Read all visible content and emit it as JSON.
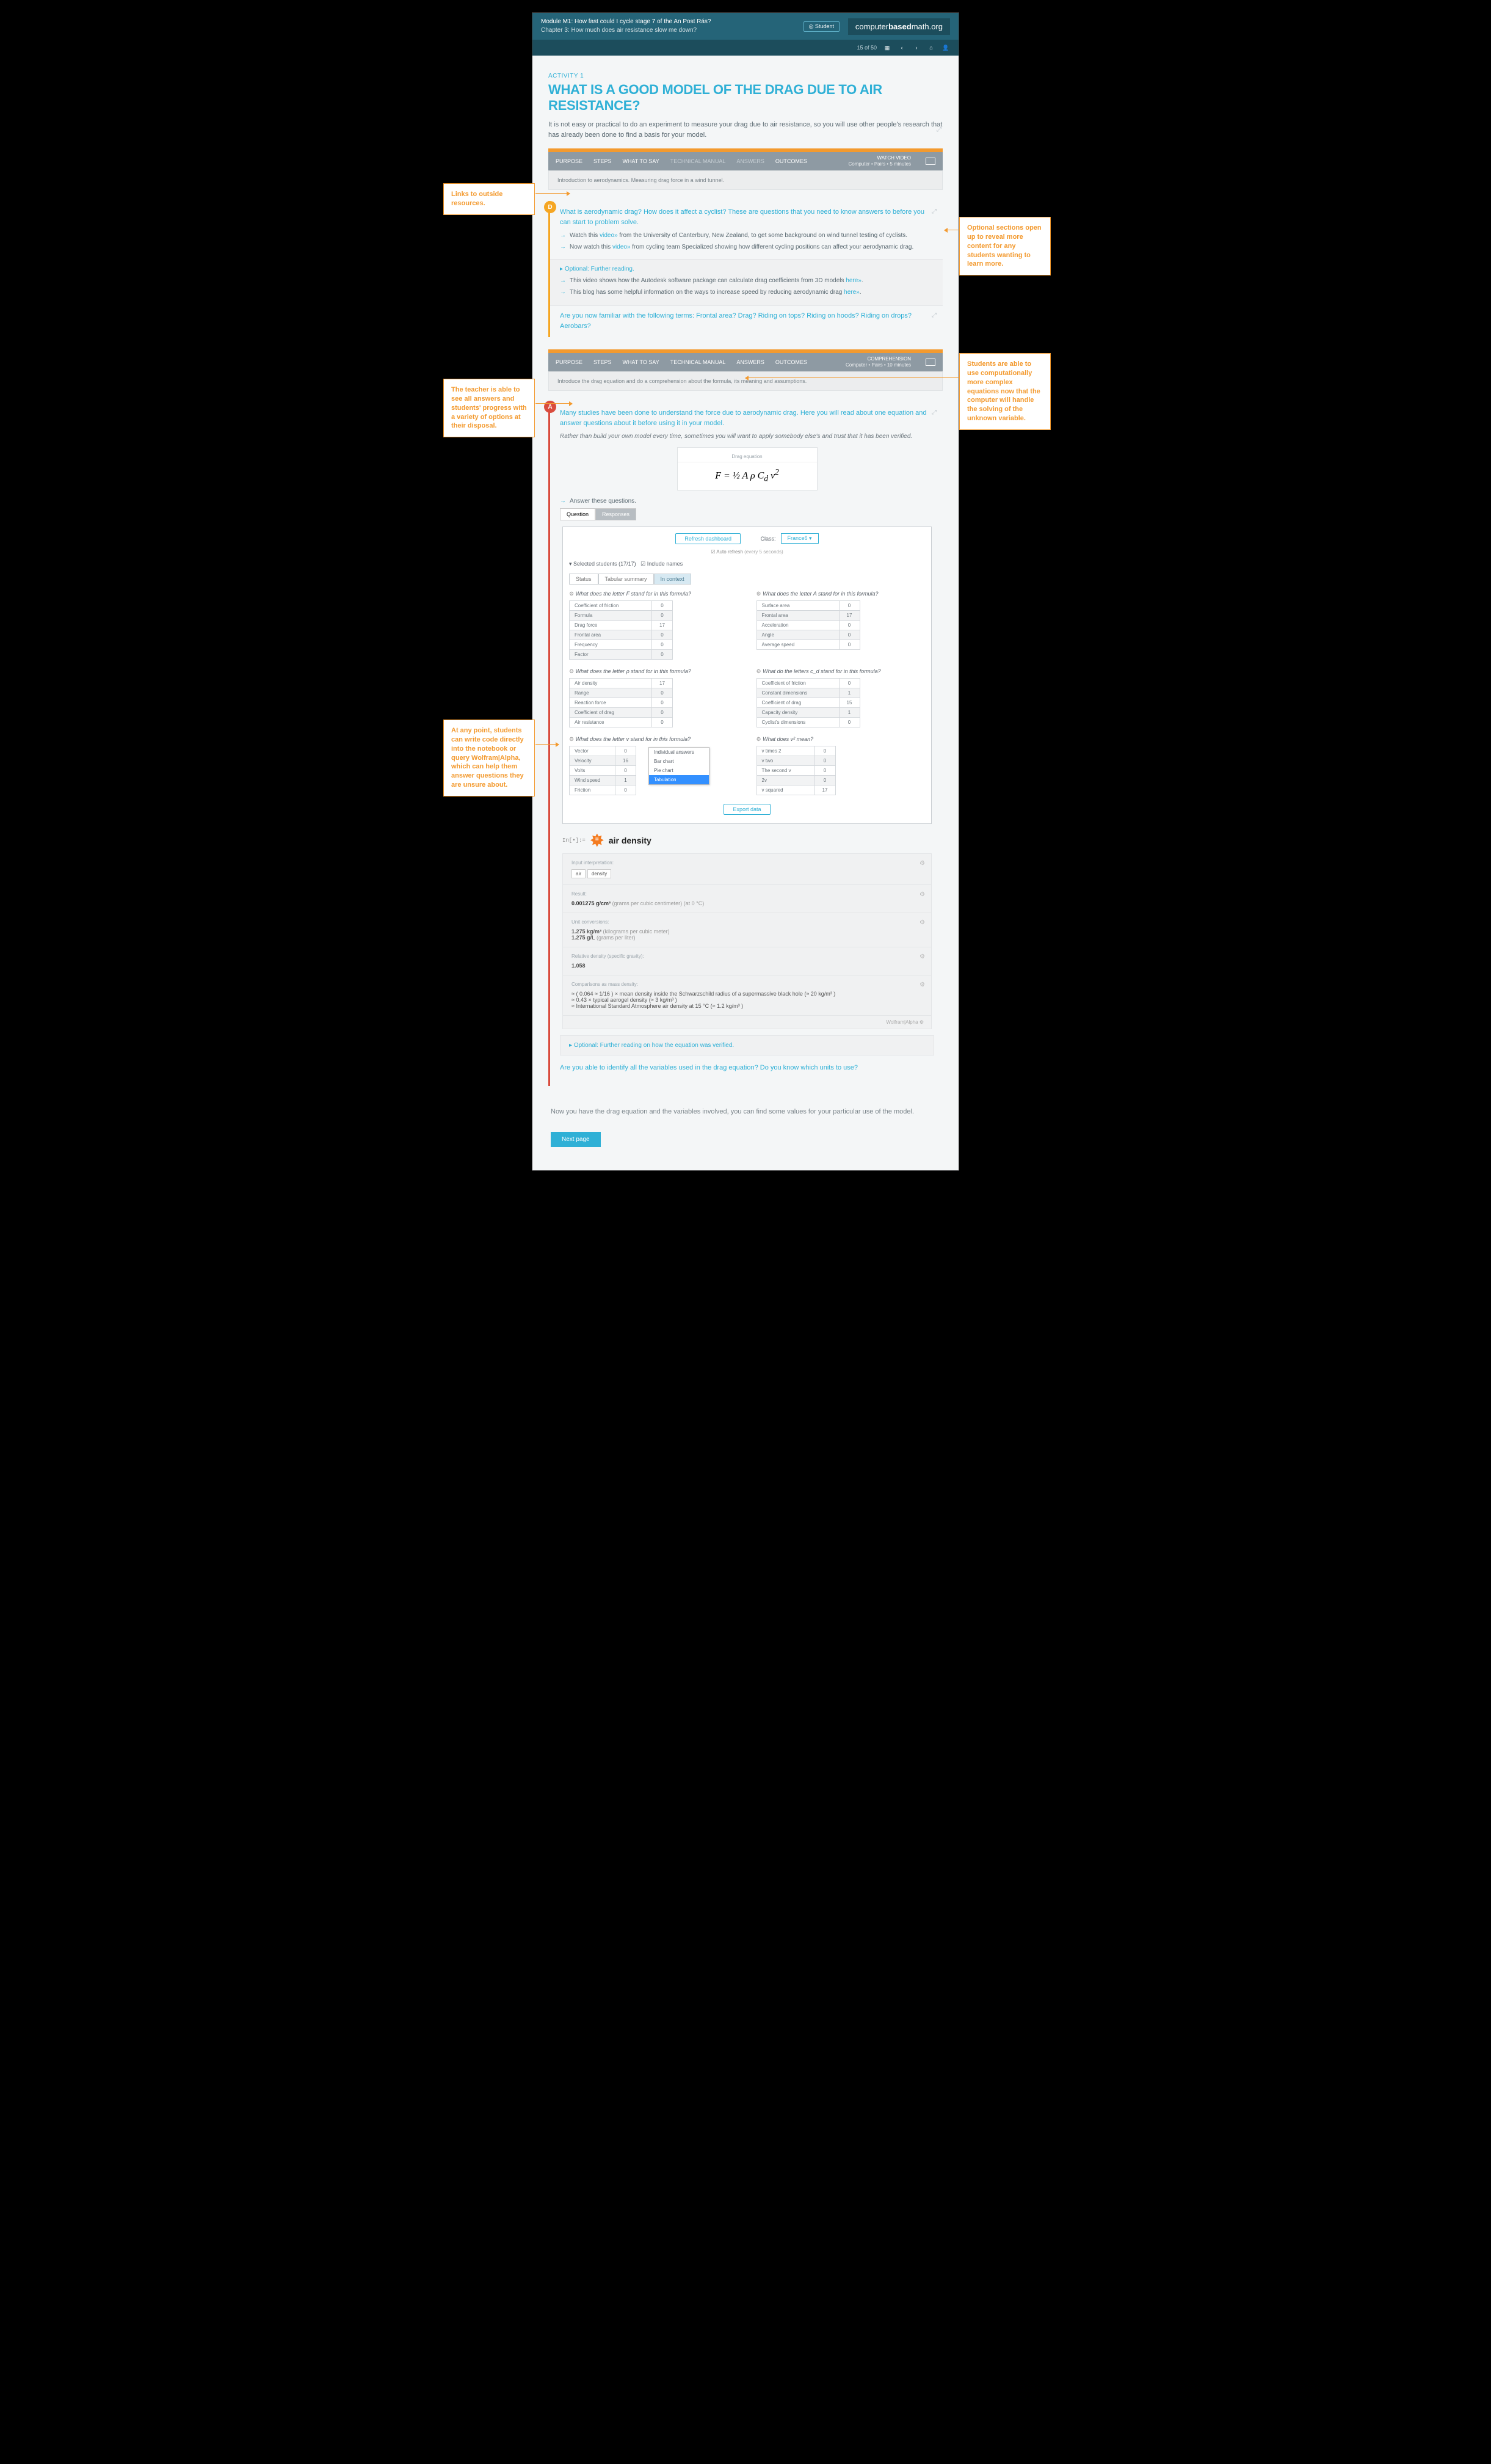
{
  "header": {
    "module": "Module M1: How fast could I cycle stage 7 of the An Post Rás?",
    "chapter": "Chapter 3: How much does air resistance slow me down?",
    "brand_light": "computer",
    "brand_bold": "based",
    "brand_end": "math.org",
    "student": "Student",
    "pagepos": "15 of 50"
  },
  "activity": {
    "label": "ACTIVITY 1",
    "title": "WHAT IS A GOOD MODEL OF THE DRAG DUE TO AIR RESISTANCE?",
    "intro": "It is not easy or practical to do an experiment to measure your drag due to air resistance, so you will use other people's research that has already been done to find a basis for your model."
  },
  "tabs": {
    "purpose": "PURPOSE",
    "steps": "STEPS",
    "say": "WHAT TO SAY",
    "tech": "TECHNICAL MANUAL",
    "answers": "ANSWERS",
    "outcomes": "OUTCOMES",
    "watch": "WATCH VIDEO",
    "watch_sub": "Computer • Pairs • 5 minutes",
    "desc1": "Introduction to aerodynamics. Measuring drag force in a wind tunnel.",
    "comp": "COMPREHENSION",
    "comp_sub": "Computer • Pairs • 10 minutes",
    "desc2": "Introduce the drag equation and do a comprehension about the formula, its meaning and assumptions."
  },
  "d": {
    "q1": "What is aerodynamic drag? How does it affect a cyclist? These are questions that you need to know answers to before you can start to problem solve.",
    "l1a": "Watch this ",
    "l1b": " from the University of Canterbury, New Zealand, to get some background on wind tunnel testing of cyclists.",
    "l2a": "Now watch this ",
    "l2b": " from cycling team Specialized showing how different cycling positions can affect your aerodynamic drag.",
    "link": "video»",
    "opt_hd": "Optional: Further reading.",
    "opt1a": "This video shows how the Autodesk software package can calculate drag coefficients from 3D models ",
    "opt2a": "This blog has some helpful information on the ways to increase speed by reducing aerodynamic drag ",
    "here": "here»",
    "q2": "Are you now familiar with the following terms: Frontal area? Drag? Riding on tops? Riding on hoods? Riding on drops? Aerobars?"
  },
  "a": {
    "q1": "Many studies have been done to understand the force due to aerodynamic drag. Here you will read about one equation and answer questions about it before using it in your model.",
    "sub": "Rather than build your own model every time, sometimes you will want to apply somebody else's and trust that it has been verified.",
    "eq_lbl": "Drag equation",
    "ans": "Answer these questions."
  },
  "dash": {
    "tab_q": "Question",
    "tab_r": "Responses",
    "refresh": "Refresh dashboard",
    "class": "Class:",
    "class_val": "France6",
    "auto": "Auto refresh",
    "auto_sub": "(every 5 seconds)",
    "sel": "Selected students (17/17)",
    "inc": "Include names",
    "vt_status": "Status",
    "vt_tab": "Tabular summary",
    "vt_ctx": "In context",
    "export": "Export data",
    "q_F": "What does the letter F stand for in this formula?",
    "r_F": [
      [
        "Coefficient of friction",
        "0"
      ],
      [
        "Formula",
        "0"
      ],
      [
        "Drag force",
        "17"
      ],
      [
        "Frontal area",
        "0"
      ],
      [
        "Frequency",
        "0"
      ],
      [
        "Factor",
        "0"
      ]
    ],
    "q_A": "What does the letter A stand for in this formula?",
    "r_A": [
      [
        "Surface area",
        "0"
      ],
      [
        "Frontal area",
        "17"
      ],
      [
        "Acceleration",
        "0"
      ],
      [
        "Angle",
        "0"
      ],
      [
        "Average speed",
        "0"
      ]
    ],
    "q_rho": "What does the letter ρ stand for in this formula?",
    "r_rho": [
      [
        "Air density",
        "17"
      ],
      [
        "Range",
        "0"
      ],
      [
        "Reaction force",
        "0"
      ],
      [
        "Coefficient of drag",
        "0"
      ],
      [
        "Air resistance",
        "0"
      ]
    ],
    "q_cd": "What do the letters c_d stand for in this formula?",
    "r_cd": [
      [
        "Coefficient of friction",
        "0"
      ],
      [
        "Constant dimensions",
        "1"
      ],
      [
        "Coefficient of drag",
        "15"
      ],
      [
        "Capacity density",
        "1"
      ],
      [
        "Cyclist's dimensions",
        "0"
      ]
    ],
    "q_v": "What does the letter v stand for in this formula?",
    "r_v": [
      [
        "Vector",
        "0"
      ],
      [
        "Velocity",
        "16"
      ],
      [
        "Volts",
        "0"
      ],
      [
        "Wind speed",
        "1"
      ],
      [
        "Friction",
        "0"
      ]
    ],
    "q_v2": "What does v² mean?",
    "r_v2": [
      [
        "v times 2",
        "0"
      ],
      [
        "v two",
        "0"
      ],
      [
        "The second v",
        "0"
      ],
      [
        "2v",
        "0"
      ],
      [
        "v squared",
        "17"
      ]
    ],
    "dd": [
      "Individual answers",
      "Bar chart",
      "Pie chart",
      "Tabulation"
    ]
  },
  "wa": {
    "in": "In[•]:=",
    "q": "air density",
    "inp": "Input interpretation:",
    "res": "Result:",
    "res_v": "0.001275 g/cm³",
    "res_n": "(grams per cubic centimeter)  (at 0 °C)",
    "uc": "Unit conversions:",
    "uc1": "1.275 kg/m³",
    "uc1n": "(kilograms per cubic meter)",
    "uc2": "1.275 g/L",
    "uc2n": "(grams per liter)",
    "rd": "Relative density (specific gravity):",
    "rd_v": "1.058",
    "cm": "Comparisons as mass density:",
    "cm1": "≈ ( 0.064 ≈ 1/16 ) × mean density inside the Schwarzschild radius of a supermassive black hole (≈ 20 kg/m³ )",
    "cm2": "≈ 0.43 × typical aerogel density (≈ 3 kg/m³ )",
    "cm3": "≈ International Standard Atmosphere air density at 15 °C (≈ 1.2 kg/m³ )",
    "foot": "Wolfram|Alpha"
  },
  "end": {
    "opt": "Optional: Further reading on how the equation was verified.",
    "q": "Are you able to identify all the variables used in the drag equation? Do you know which units to use?",
    "body": "Now you have the drag equation and the variables involved, you can find some values for your particular use of the model.",
    "next": "Next page"
  },
  "callouts": {
    "c1": "Links to outside resources.",
    "c2": "Optional sections open up to reveal more content for any students wanting to learn more.",
    "c3": "Students are able to use computationally more complex equations now that the computer will handle the solving of the unknown variable.",
    "c4": "The teacher is able to see all answers and students' progress with a variety of options at their disposal.",
    "c5": "At any point, students can write code directly into the notebook or query Wolfram|Alpha, which can help them answer questions they are unsure about."
  }
}
